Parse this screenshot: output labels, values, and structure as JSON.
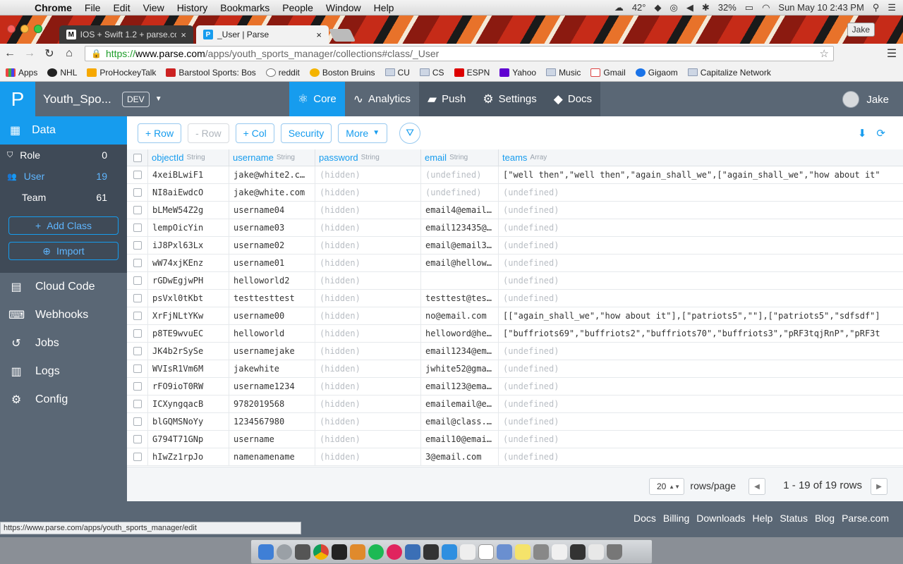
{
  "menubar": {
    "app": "Chrome",
    "menus": [
      "File",
      "Edit",
      "View",
      "History",
      "Bookmarks",
      "People",
      "Window",
      "Help"
    ],
    "temperature": "42°",
    "battery": "32%",
    "datetime": "Sun May 10  2:43 PM"
  },
  "tabs": [
    {
      "title": "IOS + Swift 1.2 + parse.co",
      "fav": "M"
    },
    {
      "title": "_User | Parse",
      "fav": "P"
    }
  ],
  "profile": "Jake",
  "address": {
    "scheme": "https://",
    "host": "www.parse.com",
    "path": "/apps/youth_sports_manager/collections#class/_User"
  },
  "bookmarks": [
    "Apps",
    "NHL",
    "ProHockeyTalk",
    "Barstool Sports: Bos",
    "reddit",
    "Boston Bruins",
    "CU",
    "CS",
    "ESPN",
    "Yahoo",
    "Music",
    "Gmail",
    "Gigaom",
    "Capitalize Network"
  ],
  "parse": {
    "logo": "P",
    "app_name": "Youth_Spo...",
    "env": "DEV",
    "nav": [
      "Core",
      "Analytics",
      "Push",
      "Settings",
      "Docs"
    ],
    "user": "Jake"
  },
  "sidebar": {
    "data_label": "Data",
    "classes": [
      {
        "name": "Role",
        "count": "0"
      },
      {
        "name": "User",
        "count": "19"
      },
      {
        "name": "Team",
        "count": "61"
      }
    ],
    "add_class": "Add Class",
    "import": "Import",
    "nav": [
      "Cloud Code",
      "Webhooks",
      "Jobs",
      "Logs",
      "Config"
    ]
  },
  "toolbar": {
    "add_row": "+ Row",
    "del_row": "- Row",
    "add_col": "+ Col",
    "security": "Security",
    "more": "More"
  },
  "table": {
    "columns": [
      {
        "name": "objectId",
        "type": "String"
      },
      {
        "name": "username",
        "type": "String"
      },
      {
        "name": "password",
        "type": "String"
      },
      {
        "name": "email",
        "type": "String"
      },
      {
        "name": "teams",
        "type": "Array"
      }
    ],
    "rows": [
      [
        "4xeiBLwiF1",
        "jake@white2.c…",
        "(hidden)",
        "(undefined)",
        "[\"well then\",\"well then\",\"again_shall_we\",[\"again_shall_we\",\"how about it\""
      ],
      [
        "NI8aiEwdcO",
        "jake@white.com",
        "(hidden)",
        "(undefined)",
        "(undefined)"
      ],
      [
        "bLMeW54Z2g",
        "username04",
        "(hidden)",
        "email4@email…",
        "(undefined)"
      ],
      [
        "lempOicYin",
        "username03",
        "(hidden)",
        "email123435@…",
        "(undefined)"
      ],
      [
        "iJ8Pxl63Lx",
        "username02",
        "(hidden)",
        "email@email3…",
        "(undefined)"
      ],
      [
        "wW74xjKEnz",
        "username01",
        "(hidden)",
        "email@hellow…",
        "(undefined)"
      ],
      [
        "rGDwEgjwPH",
        "helloworld2",
        "(hidden)",
        "",
        "(undefined)"
      ],
      [
        "psVxl0tKbt",
        "testtesttest",
        "(hidden)",
        "testtest@tes…",
        "(undefined)"
      ],
      [
        "XrFjNLtYKw",
        "username00",
        "(hidden)",
        "no@email.com",
        "[[\"again_shall_we\",\"how about it\"],[\"patriots5\",\"\"],[\"patriots5\",\"sdfsdf\"]"
      ],
      [
        "p8TE9wvuEC",
        "helloworld",
        "(hidden)",
        "helloword@he…",
        "[\"buffriots69\",\"buffriots2\",\"buffriots70\",\"buffriots3\",\"pRF3tqjRnP\",\"pRF3t"
      ],
      [
        "JK4b2rSySe",
        "usernamejake",
        "(hidden)",
        "email1234@em…",
        "(undefined)"
      ],
      [
        "WVIsR1Vm6M",
        "jakewhite",
        "(hidden)",
        "jwhite52@gma…",
        "(undefined)"
      ],
      [
        "rFO9ioT0RW",
        "username1234",
        "(hidden)",
        "email123@ema…",
        "(undefined)"
      ],
      [
        "ICXyngqacB",
        "9782019568",
        "(hidden)",
        "emailemail@e…",
        "(undefined)"
      ],
      [
        "blGQMSNoYy",
        "1234567980",
        "(hidden)",
        "email@class.…",
        "(undefined)"
      ],
      [
        "G794T71GNp",
        "username",
        "(hidden)",
        "email10@emai…",
        "(undefined)"
      ],
      [
        "hIwZz1rpJo",
        "namenamename",
        "(hidden)",
        "3@email.com",
        "(undefined)"
      ]
    ]
  },
  "pager": {
    "per_page": "20",
    "rows_page_label": "rows/page",
    "range": "1 - 19 of 19 rows"
  },
  "footer": [
    "Docs",
    "Billing",
    "Downloads",
    "Help",
    "Status",
    "Blog",
    "Parse.com"
  ],
  "status_url": "https://www.parse.com/apps/youth_sports_manager/edit",
  "colors": {
    "accent": "#169cee",
    "header": "#5a6775"
  }
}
